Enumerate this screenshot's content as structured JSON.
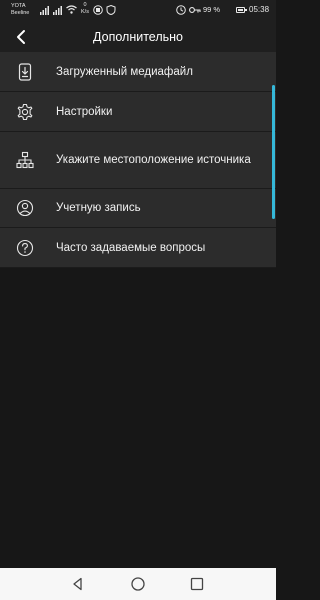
{
  "status_bar": {
    "carrier_1": "YOTA",
    "carrier_2": "Beeline",
    "speed_value": "0",
    "speed_unit": "K/s",
    "battery_percent": "99 %",
    "battery_level": 0.99,
    "time": "05:38"
  },
  "app_bar": {
    "title": "Дополнительно",
    "back_icon": "arrow-left-icon"
  },
  "menu": {
    "items": [
      {
        "label": "Загруженный медиафайл",
        "icon": "phone-download-icon"
      },
      {
        "label": "Настройки",
        "icon": "gear-icon"
      },
      {
        "label": "Укажите местоположение источника",
        "icon": "sitemap-icon"
      },
      {
        "label": "Учетную запись",
        "icon": "account-icon"
      },
      {
        "label": "Часто задаваемые вопросы",
        "icon": "help-circle-icon"
      }
    ]
  },
  "colors": {
    "background": "#171717",
    "menu_background": "#2c2c2c",
    "bar_background": "#1f1f1f",
    "scrollbar": "#35b8d9",
    "navbar": "#f7f7f7"
  }
}
